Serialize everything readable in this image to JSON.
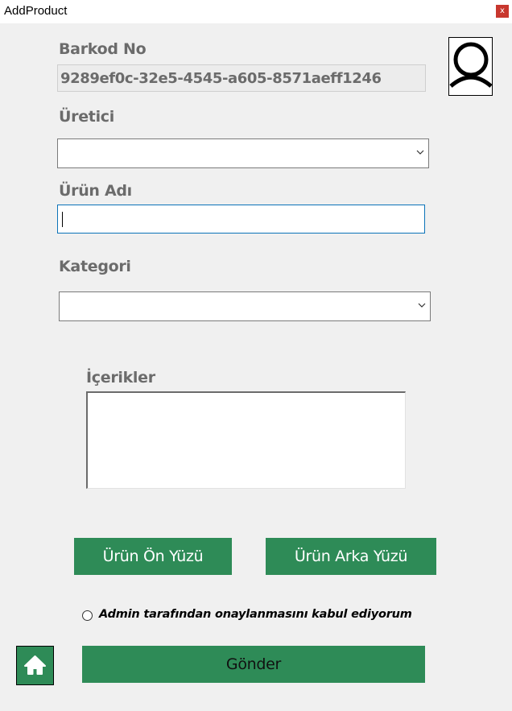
{
  "window": {
    "title": "AddProduct",
    "close_symbol": "x"
  },
  "form": {
    "barcode_label": "Barkod No",
    "barcode_value": "9289ef0c-32e5-4545-a605-8571aeff1246",
    "manufacturer_label": "Üretici",
    "manufacturer_value": "",
    "product_name_label": "Ürün Adı",
    "product_name_value": "",
    "category_label": "Kategori",
    "category_value": "",
    "contents_label": "İçerikler",
    "contents_value": ""
  },
  "buttons": {
    "front_image": "Ürün Ön Yüzü",
    "back_image": "Ürün Arka Yüzü",
    "submit": "Gönder"
  },
  "consent": {
    "label": "Admin tarafından onaylanmasını kabul ediyorum",
    "checked": false
  },
  "icons": {
    "avatar": "user-avatar-icon",
    "home": "home-icon",
    "dropdown": "chevron-down-icon"
  },
  "colors": {
    "accent": "#2e8b57",
    "focus_border": "#0b73b8",
    "close": "#c8372e"
  }
}
